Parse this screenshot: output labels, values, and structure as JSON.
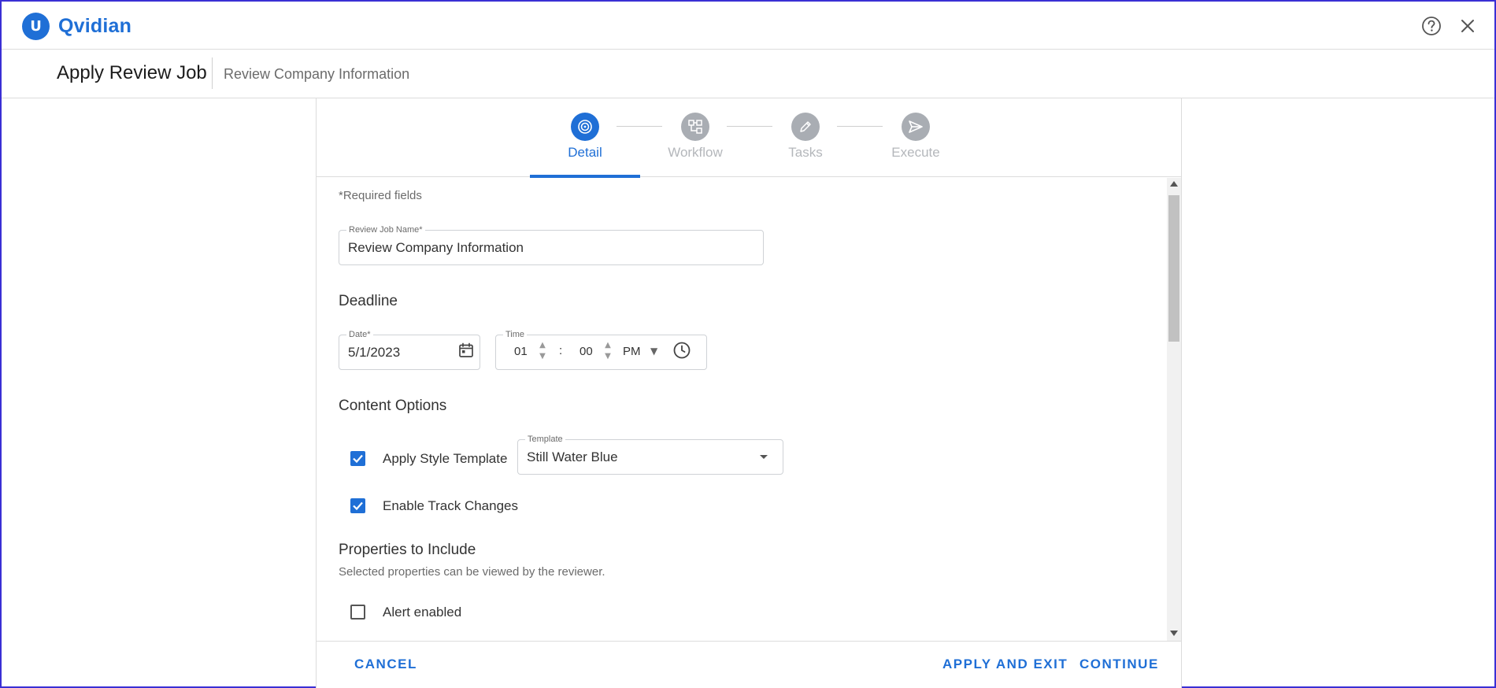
{
  "app": {
    "brand_letter": "U",
    "brand_name": "Qvidian"
  },
  "header": {
    "title": "Apply Review Job",
    "subtitle": "Review Company Information"
  },
  "stepper": {
    "steps": [
      {
        "label": "Detail",
        "state": "active"
      },
      {
        "label": "Workflow",
        "state": "inactive"
      },
      {
        "label": "Tasks",
        "state": "inactive"
      },
      {
        "label": "Execute",
        "state": "inactive"
      }
    ]
  },
  "form": {
    "required_note": "*Required fields",
    "job_name": {
      "label": "Review Job Name*",
      "value": "Review Company Information"
    },
    "deadline": {
      "heading": "Deadline",
      "date": {
        "label": "Date*",
        "value": "5/1/2023"
      },
      "time": {
        "label": "Time",
        "hour": "01",
        "separator": ":",
        "minute": "00",
        "period": "PM"
      }
    },
    "content_options": {
      "heading": "Content Options",
      "apply_style_template": {
        "label": "Apply Style Template",
        "checked": true
      },
      "template": {
        "label": "Template",
        "value": "Still Water Blue"
      },
      "enable_track_changes": {
        "label": "Enable Track Changes",
        "checked": true
      }
    },
    "properties": {
      "heading": "Properties to Include",
      "note": "Selected properties can be viewed by the reviewer.",
      "items": [
        {
          "label": "Alert enabled",
          "checked": false
        }
      ]
    }
  },
  "footer": {
    "cancel": "CANCEL",
    "apply_and_exit": "APPLY AND EXIT",
    "continue": "CONTINUE"
  },
  "colors": {
    "accent": "#1f6fd6",
    "inactive_step": "#a9adb3",
    "frame": "#3a2fd4"
  },
  "icons": {
    "help": "help-circle-icon",
    "close": "close-icon",
    "detail_step": "target-icon",
    "workflow_step": "workflow-icon",
    "tasks_step": "pencil-icon",
    "execute_step": "send-icon",
    "calendar": "calendar-icon",
    "clock": "clock-icon"
  }
}
